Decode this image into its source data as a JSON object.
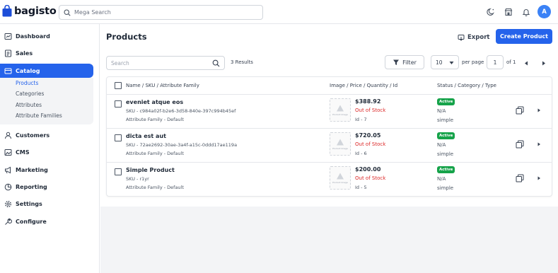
{
  "header": {
    "logo_text": "bagisto",
    "search_placeholder": "Mega Search",
    "avatar_initial": "A"
  },
  "sidebar": {
    "items": [
      {
        "label": "Dashboard",
        "icon": "dashboard-icon"
      },
      {
        "label": "Sales",
        "icon": "sales-icon"
      },
      {
        "label": "Catalog",
        "icon": "catalog-icon",
        "active": true
      },
      {
        "label": "Customers",
        "icon": "customers-icon"
      },
      {
        "label": "CMS",
        "icon": "cms-icon"
      },
      {
        "label": "Marketing",
        "icon": "marketing-icon"
      },
      {
        "label": "Reporting",
        "icon": "reporting-icon"
      },
      {
        "label": "Settings",
        "icon": "settings-icon"
      },
      {
        "label": "Configure",
        "icon": "configure-icon"
      }
    ],
    "catalog_sub": [
      "Products",
      "Categories",
      "Attributes",
      "Attribute Families"
    ]
  },
  "page": {
    "title": "Products",
    "export_label": "Export",
    "create_label": "Create Product"
  },
  "toolbar": {
    "search_placeholder": "Search",
    "results": "3 Results",
    "filter_label": "Filter",
    "per_page_value": "10",
    "per_page_label": "per page",
    "page_value": "1",
    "of_label": "of 1"
  },
  "table": {
    "headers": {
      "name": "Name / SKU / Attribute Family",
      "image": "Image / Price / Quantity / Id",
      "status": "Status / Category / Type"
    },
    "image_placeholder": "Product Image",
    "rows": [
      {
        "name": "eveniet atque eos",
        "sku": "SKU - c984a02f-b2e6-3d58-840e-397c994b45ef",
        "family": "Attribute Family - Default",
        "price": "$388.92",
        "stock": "Out of Stock",
        "id": "Id - 7",
        "status": "Active",
        "category": "N/A",
        "type": "simple"
      },
      {
        "name": "dicta est aut",
        "sku": "SKU - 72ae2692-30ae-3a4f-a15c-0ddd17ae119a",
        "family": "Attribute Family - Default",
        "price": "$720.05",
        "stock": "Out of Stock",
        "id": "Id - 6",
        "status": "Active",
        "category": "N/A",
        "type": "simple"
      },
      {
        "name": "Simple Product",
        "sku": "SKU - r1yr",
        "family": "Attribute Family - Default",
        "price": "$200.00",
        "stock": "Out of Stock",
        "id": "Id - 5",
        "status": "Active",
        "category": "N/A",
        "type": "simple"
      }
    ]
  },
  "colors": {
    "primary": "#2563eb",
    "active_badge": "#16a34a",
    "out_of_stock": "#dc2626"
  }
}
